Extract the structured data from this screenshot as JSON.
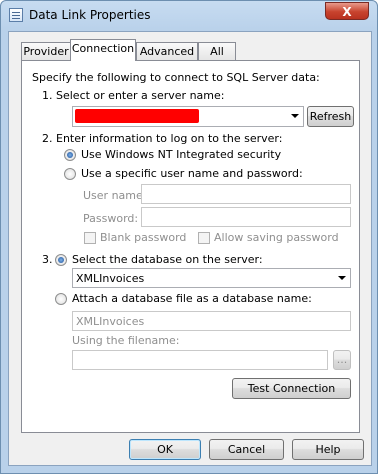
{
  "window": {
    "title": "Data Link Properties",
    "close_label": "X"
  },
  "tabs": [
    {
      "label": "Provider"
    },
    {
      "label": "Connection"
    },
    {
      "label": "Advanced"
    },
    {
      "label": "All"
    }
  ],
  "connection": {
    "intro": "Specify the following to connect to SQL Server data:",
    "step1_label": "1. Select or enter a server name:",
    "refresh_button": "Refresh",
    "step2_label": "2. Enter information to log on to the server:",
    "auth_nt": "Use Windows NT Integrated security",
    "auth_specific": "Use a specific user name and password:",
    "username_label": "User name:",
    "username_value": "",
    "password_label": "Password:",
    "password_value": "",
    "blank_password": "Blank password",
    "allow_saving": "Allow saving password",
    "step3_prefix": "3.",
    "select_db_label": "Select the database on the server:",
    "database_value": "XMLInvoices",
    "attach_label": "Attach a database file as a database name:",
    "attach_name_value": "XMLInvoices",
    "filename_label": "Using the filename:",
    "filename_value": "",
    "browse_button": "...",
    "test_button": "Test Connection"
  },
  "footer": {
    "ok": "OK",
    "cancel": "Cancel",
    "help": "Help"
  },
  "colors": {
    "redaction": "#ff0000",
    "window_frame": "#b9d1ea",
    "close_button": "#c8432e"
  }
}
